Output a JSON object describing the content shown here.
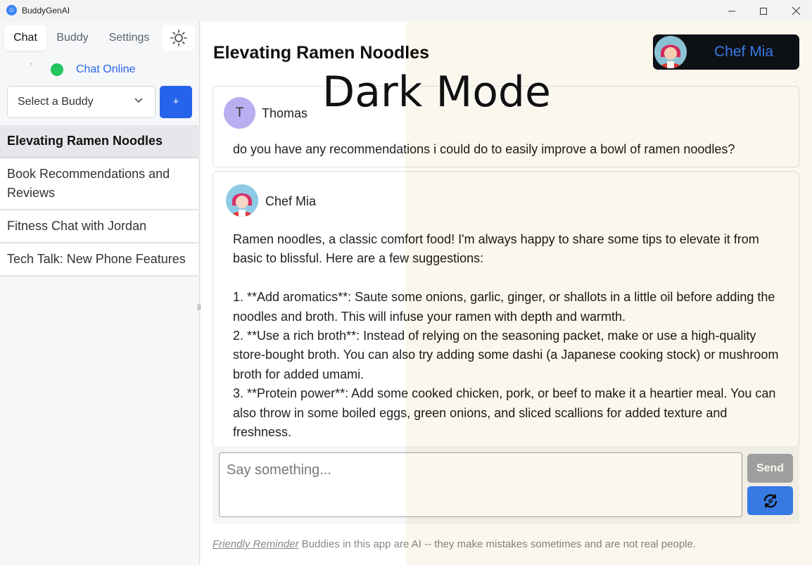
{
  "window": {
    "title": "BuddyGenAI",
    "icon": "app-logo-icon",
    "controls": [
      "minimize-icon",
      "maximize-icon",
      "close-icon"
    ]
  },
  "sidebar": {
    "tabs": [
      {
        "label": "Chat",
        "active": true
      },
      {
        "label": "Buddy",
        "active": false
      },
      {
        "label": "Settings",
        "active": false
      }
    ],
    "theme_icon": "sun-icon",
    "status": {
      "label": "Chat Online",
      "tick": "`",
      "color": "#22c55e"
    },
    "buddy_select": {
      "placeholder": "Select a Buddy"
    },
    "add_button": "+",
    "conversations": [
      {
        "title": "Elevating Ramen Noodles",
        "active": true
      },
      {
        "title": "Book Recommendations and Reviews",
        "active": false
      },
      {
        "title": "Fitness Chat with Jordan",
        "active": false
      },
      {
        "title": "Tech Talk: New Phone Features",
        "active": false
      }
    ]
  },
  "main": {
    "title": "Elevating Ramen Noodles",
    "buddy": {
      "name": "Chef Mia"
    },
    "messages": [
      {
        "sender": "Thomas",
        "avatar_initial": "T",
        "text": "do you have any recommendations i could do to easily improve a bowl of ramen noodles?"
      },
      {
        "sender": "Chef Mia",
        "intro": "Ramen noodles, a classic comfort food! I'm always happy to share some tips to elevate it from basic to blissful. Here are a few suggestions:",
        "items": [
          "1. **Add aromatics**: Saute some onions, garlic, ginger, or shallots in a little oil before adding the noodles and broth. This will infuse your ramen with depth and warmth.",
          "2. **Use a rich broth**: Instead of relying on the seasoning packet, make or use a high-quality store-bought broth. You can also try adding some dashi (a Japanese cooking stock) or mushroom broth for added umami.",
          "3. **Protein power**: Add some cooked chicken, pork, or beef to make it a heartier meal. You can also throw in some boiled eggs, green onions, and sliced scallions for added texture and freshness."
        ]
      }
    ],
    "input": {
      "placeholder": "Say something..."
    },
    "send_label": "Send",
    "regen_icon": "refresh-icon",
    "footer": {
      "link": "Friendly Reminder",
      "text": " Buddies in this app are AI -- they make mistakes sometimes and are not real people."
    }
  },
  "overlay": {
    "label": "Dark Mode"
  }
}
